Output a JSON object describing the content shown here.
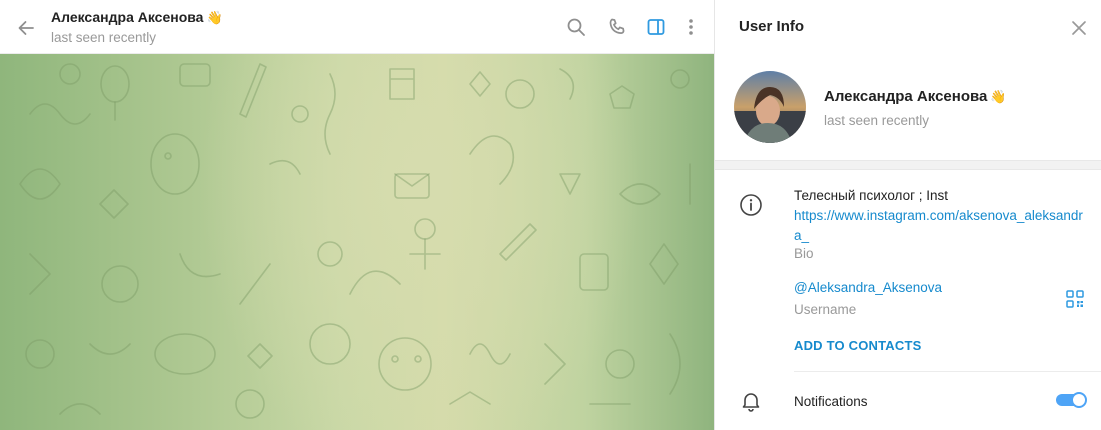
{
  "chat": {
    "title": "Александра Аксенова",
    "status": "last seen recently",
    "emoji": "👋"
  },
  "info": {
    "panel_title": "User Info",
    "name": "Александра Аксенова",
    "emoji": "👋",
    "status": "last seen recently",
    "bio": "Телесный психолог ; Inst",
    "bio_link": "https://www.instagram.com/aksenova_aleksandra_",
    "bio_caption": "Bio",
    "username": "@Aleksandra_Aksenova",
    "username_caption": "Username",
    "add_contact": "ADD TO CONTACTS",
    "notifications_label": "Notifications",
    "notifications_on": true
  },
  "icons": {
    "back": "arrow-left-icon",
    "search": "search-icon",
    "call": "phone-icon",
    "sidebar": "sidebar-toggle-icon",
    "more": "more-vertical-icon",
    "close": "close-icon",
    "info": "info-icon",
    "qr": "qr-code-icon",
    "bell": "bell-icon"
  },
  "colors": {
    "accent": "#168acd",
    "toggle": "#4ea4f6",
    "muted": "#999999",
    "sidebar_active": "#2f9ae0"
  }
}
